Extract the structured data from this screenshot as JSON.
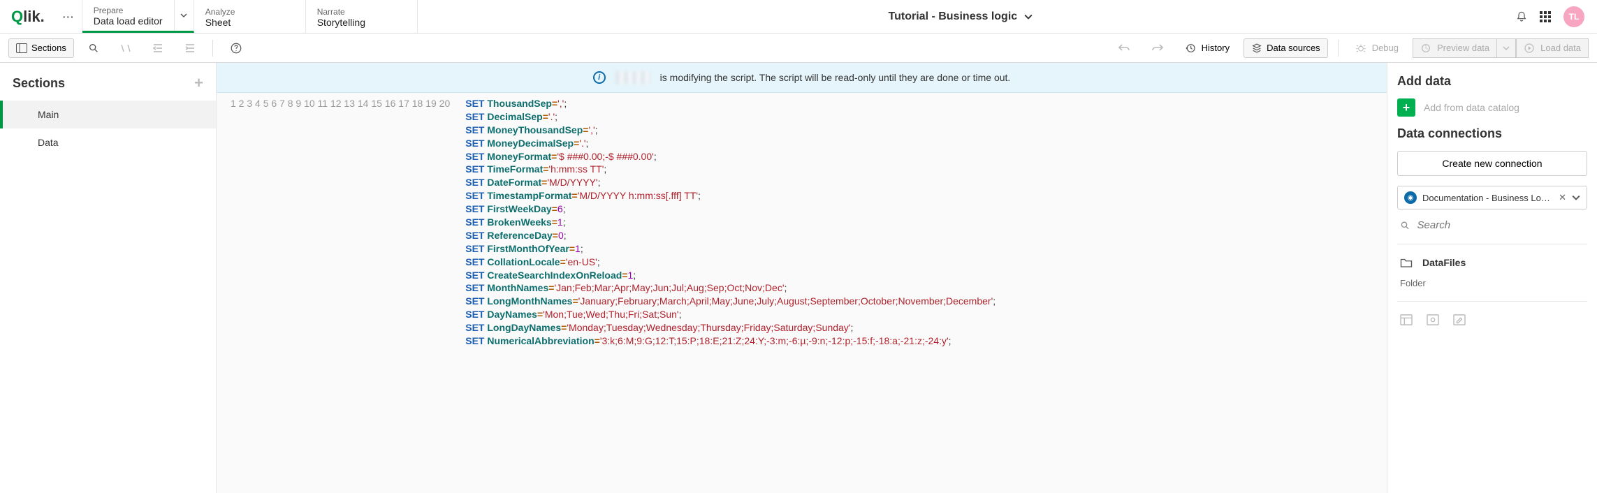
{
  "logo": {
    "text": "Qlik",
    "accent_char": "Q"
  },
  "nav": {
    "prepare": {
      "sup": "Prepare",
      "main": "Data load editor"
    },
    "analyze": {
      "sup": "Analyze",
      "main": "Sheet"
    },
    "narrate": {
      "sup": "Narrate",
      "main": "Storytelling"
    }
  },
  "app_title": "Tutorial - Business logic",
  "avatar": "TL",
  "toolbar": {
    "sections": "Sections",
    "history": "History",
    "data_sources": "Data sources",
    "debug": "Debug",
    "preview_data": "Preview data",
    "load_data": "Load data"
  },
  "sidebar": {
    "title": "Sections",
    "items": [
      {
        "label": "Main"
      },
      {
        "label": "Data"
      }
    ]
  },
  "alert": {
    "text": "is modifying the script. The script will be read-only until they are done or time out."
  },
  "code": {
    "line_count": 20,
    "lines": [
      {
        "kw": "SET",
        "var": "ThousandSep",
        "val": "','"
      },
      {
        "kw": "SET",
        "var": "DecimalSep",
        "val": "'.'"
      },
      {
        "kw": "SET",
        "var": "MoneyThousandSep",
        "val": "','"
      },
      {
        "kw": "SET",
        "var": "MoneyDecimalSep",
        "val": "'.'"
      },
      {
        "kw": "SET",
        "var": "MoneyFormat",
        "val": "'$ ###0.00;-$ ###0.00'"
      },
      {
        "kw": "SET",
        "var": "TimeFormat",
        "val": "'h:mm:ss TT'"
      },
      {
        "kw": "SET",
        "var": "DateFormat",
        "val": "'M/D/YYYY'"
      },
      {
        "kw": "SET",
        "var": "TimestampFormat",
        "val": "'M/D/YYYY h:mm:ss[.fff] TT'"
      },
      {
        "kw": "SET",
        "var": "FirstWeekDay",
        "num": "6"
      },
      {
        "kw": "SET",
        "var": "BrokenWeeks",
        "num": "1"
      },
      {
        "kw": "SET",
        "var": "ReferenceDay",
        "num": "0"
      },
      {
        "kw": "SET",
        "var": "FirstMonthOfYear",
        "num": "1"
      },
      {
        "kw": "SET",
        "var": "CollationLocale",
        "val": "'en-US'"
      },
      {
        "kw": "SET",
        "var": "CreateSearchIndexOnReload",
        "num": "1"
      },
      {
        "kw": "SET",
        "var": "MonthNames",
        "val": "'Jan;Feb;Mar;Apr;May;Jun;Jul;Aug;Sep;Oct;Nov;Dec'"
      },
      {
        "kw": "SET",
        "var": "LongMonthNames",
        "val": "'January;February;March;April;May;June;July;August;September;October;November;December'"
      },
      {
        "kw": "SET",
        "var": "DayNames",
        "val": "'Mon;Tue;Wed;Thu;Fri;Sat;Sun'"
      },
      {
        "kw": "SET",
        "var": "LongDayNames",
        "val": "'Monday;Tuesday;Wednesday;Thursday;Friday;Saturday;Sunday'"
      },
      {
        "kw": "SET",
        "var": "NumericalAbbreviation",
        "val": "'3:k;6:M;9:G;12:T;15:P;18:E;21:Z;24:Y;-3:m;-6:µ;-9:n;-12:p;-15:f;-18:a;-21:z;-24:y'"
      }
    ]
  },
  "right": {
    "add_data": "Add data",
    "add_catalog": "Add from data catalog",
    "data_connections": "Data connections",
    "create_conn": "Create new connection",
    "conn_name": "Documentation - Business Logic ...",
    "search_placeholder": "Search",
    "datafiles": "DataFiles",
    "folder": "Folder"
  }
}
